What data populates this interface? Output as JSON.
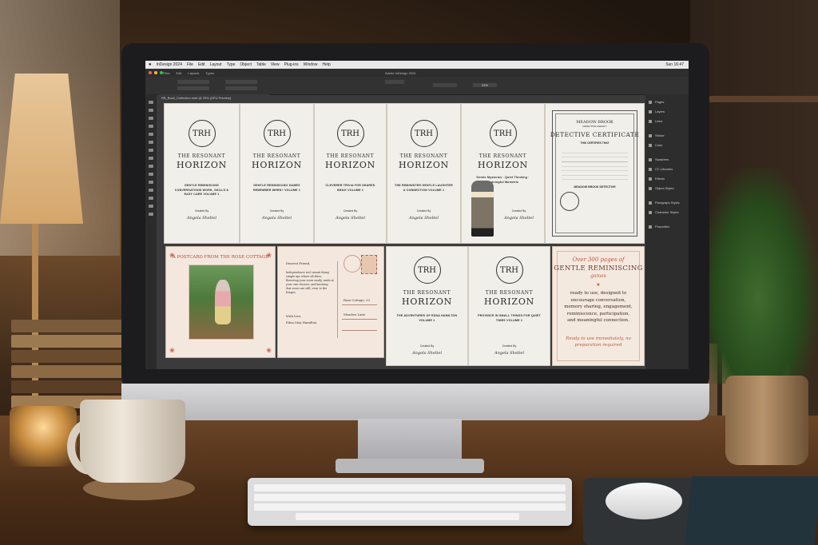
{
  "app": {
    "menu": [
      "InDesign 2024",
      "File",
      "Edit",
      "Layout",
      "Type",
      "Object",
      "Table",
      "View",
      "Plug-ins",
      "Window",
      "Help"
    ],
    "clock": "Sun 16:47",
    "window_title": "Adobe InDesign 2024",
    "document_tab": "RB_Book_Collection.indd @ 33% [GPU Preview]",
    "control_labels": [
      "Files",
      "Edit",
      "Layouts",
      "Types"
    ],
    "zoom_field": "33%",
    "colors": {
      "menubar": "#e9e9e9",
      "ui_dark": "#2d2d2d",
      "canvas": "#3b3b3b",
      "accent_promo": "#c0583f"
    }
  },
  "panels": [
    "Pages",
    "Layers",
    "Links",
    "Stroke",
    "Color",
    "Swatches",
    "CC Libraries",
    "Effects",
    "Object Styles",
    "Paragraph Styles",
    "Character Styles",
    "Properties"
  ],
  "brand": {
    "logo_text": "TRH",
    "line1": "THE RESONANT",
    "line2": "HORIZON",
    "created": "Created By",
    "signature": "Angela Sheltel"
  },
  "covers": [
    {
      "subtitle": "GENTLE REMINISCING CONVERSATIONS WORK, SKILLS & EASY CARE VOLUME 1"
    },
    {
      "subtitle": "GENTLE REMINISCING GAMES REMEMBER WHEN? VOLUME 1"
    },
    {
      "subtitle": "CLEVERER TRIVIA FOR SHARED SMILE VOLUME 1"
    },
    {
      "subtitle": "THE REMINISTER GENTLE LAUGHTER & CONNECTION VOLUME 1"
    },
    {
      "subtitle": "Gentle Mysteries · Quiet Thinking · Meaningful Moments"
    },
    {
      "subtitle": "THE ADVENTURES OF EDNA HAMILTON VOLUME 1"
    },
    {
      "subtitle": "PROVINCE IN SMALL THINGS FOR QUIET TIMES VOLUME 1"
    }
  ],
  "certificate": {
    "org": "MEADOW BROOK",
    "org_sub": "DETECTIVE AGENCY",
    "title": "DETECTIVE CERTIFICATE",
    "certify": "THIS CERTIFIES THAT",
    "award": "MEADOW BROOK DETECTIVE"
  },
  "postcard": {
    "title": "A POSTCARD FROM THE ROSE COTTAGE",
    "greeting": "Dearest Friend,",
    "body": "Independence isn't meant doing simple ups where all skies, flowering your roses easily, smile at your own choices, and knowing that roses are still, even to the fringes.",
    "closing": "With love,",
    "signoff": "Edna May Hamilton",
    "address1": "Rose Cottage, 23",
    "address2": "Meadow Lane"
  },
  "promo": {
    "line1": "Over 300 pages of",
    "line2": "GENTLE REMINISCING",
    "line3": "games",
    "body": "ready to use, designed to encourage conversation, memory sharing, engagement, reminiscence, participation, and meaningful connection.",
    "footer": "Ready to use immediately, no preparation required"
  }
}
